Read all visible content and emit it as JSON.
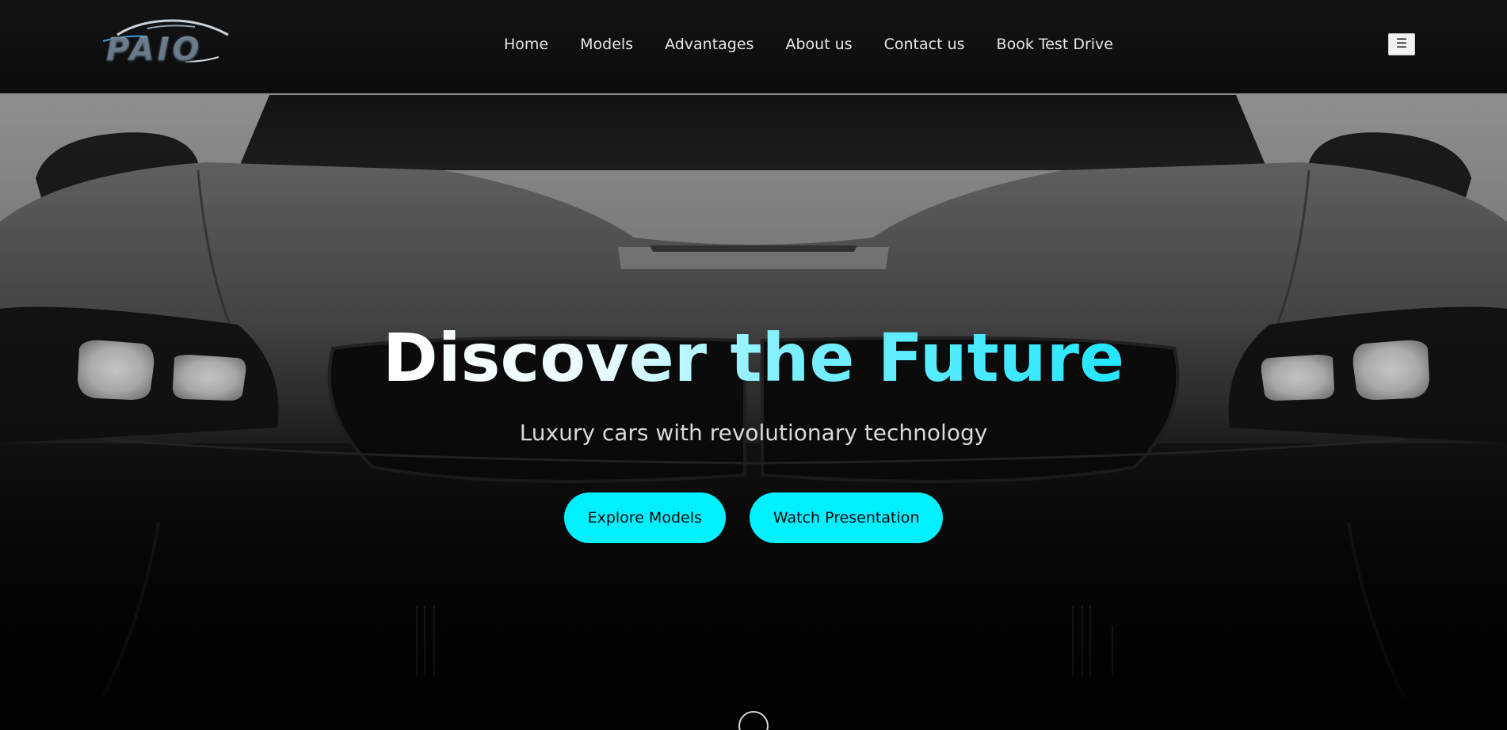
{
  "brand": {
    "logo_text": "PAIO"
  },
  "nav": {
    "links": [
      {
        "label": "Home"
      },
      {
        "label": "Models"
      },
      {
        "label": "Advantages"
      },
      {
        "label": "About us"
      },
      {
        "label": "Contact us"
      },
      {
        "label": "Book Test Drive"
      }
    ],
    "menu_toggle_label": "☰"
  },
  "hero": {
    "title": "Discover the Future",
    "subtitle": "Luxury cars with revolutionary technology",
    "buttons": {
      "primary_label": "Explore Models",
      "secondary_label": "Watch Presentation"
    }
  },
  "icons": {
    "menu": "hamburger-icon",
    "scroll": "scroll-down-icon"
  },
  "colors": {
    "accent": "#00f0ff",
    "nav_bg": "#0d0d0d",
    "text": "#e6e6e6"
  }
}
